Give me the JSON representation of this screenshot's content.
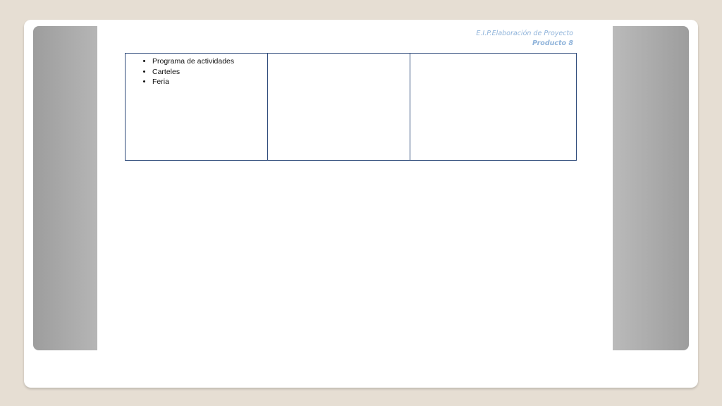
{
  "header": {
    "line1": "E.I.P.Elaboración de Proyecto",
    "line2": "Producto 8"
  },
  "table": {
    "column1_items": [
      "Programa de actividades",
      "Carteles",
      "Feria"
    ]
  }
}
